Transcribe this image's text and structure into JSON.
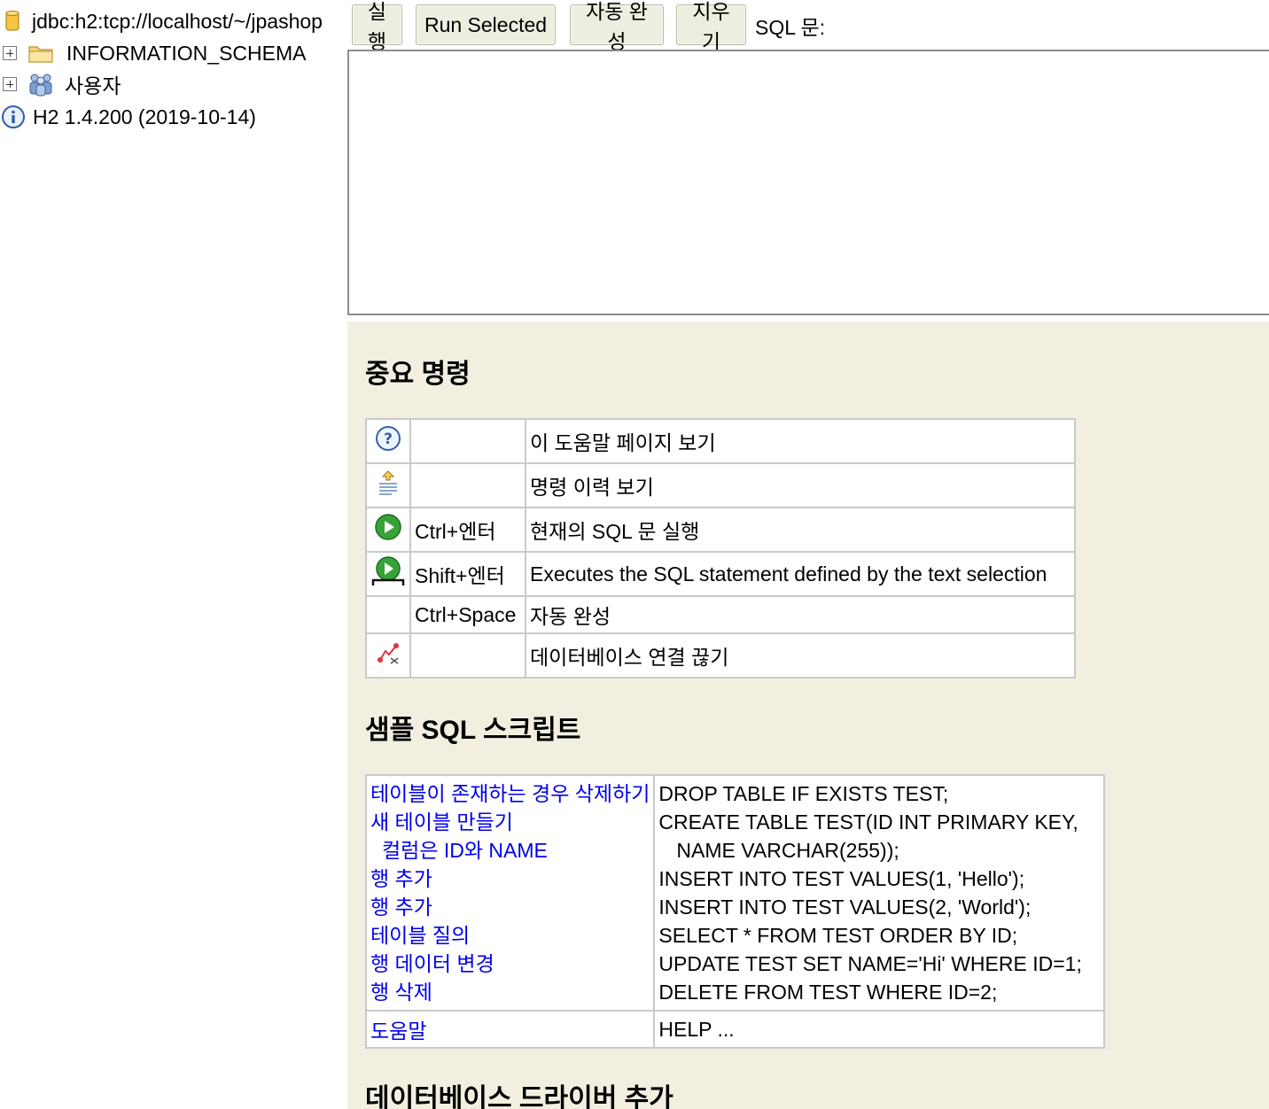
{
  "tree": {
    "connection": "jdbc:h2:tcp://localhost/~/jpashop",
    "schema": "INFORMATION_SCHEMA",
    "users": "사용자",
    "version": "H2 1.4.200 (2019-10-14)"
  },
  "toolbar": {
    "run": "실행",
    "run_selected": "Run Selected",
    "auto_complete": "자동 완성",
    "clear": "지우기",
    "sql_label": "SQL 문:"
  },
  "help": {
    "important_title": "중요 명령",
    "commands": [
      {
        "icon": "help-icon",
        "key": "",
        "desc": "이 도움말 페이지 보기"
      },
      {
        "icon": "history-icon",
        "key": "",
        "desc": "명령 이력 보기"
      },
      {
        "icon": "run-icon",
        "key": "Ctrl+엔터",
        "desc": "현재의 SQL 문 실행"
      },
      {
        "icon": "run-selected-icon",
        "key": "Shift+엔터",
        "desc": "Executes the SQL statement defined by the text selection"
      },
      {
        "icon": "",
        "key": "Ctrl+Space",
        "desc": "자동 완성"
      },
      {
        "icon": "disconnect-icon",
        "key": "",
        "desc": "데이터베이스 연결 끊기"
      }
    ],
    "sample_title": "샘플 SQL 스크립트",
    "samples": [
      {
        "label": "테이블이 존재하는 경우 삭제하기",
        "sql": "DROP TABLE IF EXISTS TEST;"
      },
      {
        "label": "새 테이블 만들기",
        "sql": "CREATE TABLE TEST(ID INT PRIMARY KEY,"
      },
      {
        "label": "컬럼은 ID와 NAME",
        "sql": "NAME VARCHAR(255));"
      },
      {
        "label": "행 추가",
        "sql": "INSERT INTO TEST VALUES(1, 'Hello');"
      },
      {
        "label": "행 추가",
        "sql": "INSERT INTO TEST VALUES(2, 'World');"
      },
      {
        "label": "테이블 질의",
        "sql": "SELECT * FROM TEST ORDER BY ID;"
      },
      {
        "label": "행 데이터 변경",
        "sql": "UPDATE TEST SET NAME='Hi' WHERE ID=1;"
      },
      {
        "label": "행 삭제",
        "sql": "DELETE FROM TEST WHERE ID=2;"
      }
    ],
    "help_row": {
      "label": "도움말",
      "sql": "HELP ..."
    },
    "driver_title": "데이터베이스 드라이버 추가"
  }
}
